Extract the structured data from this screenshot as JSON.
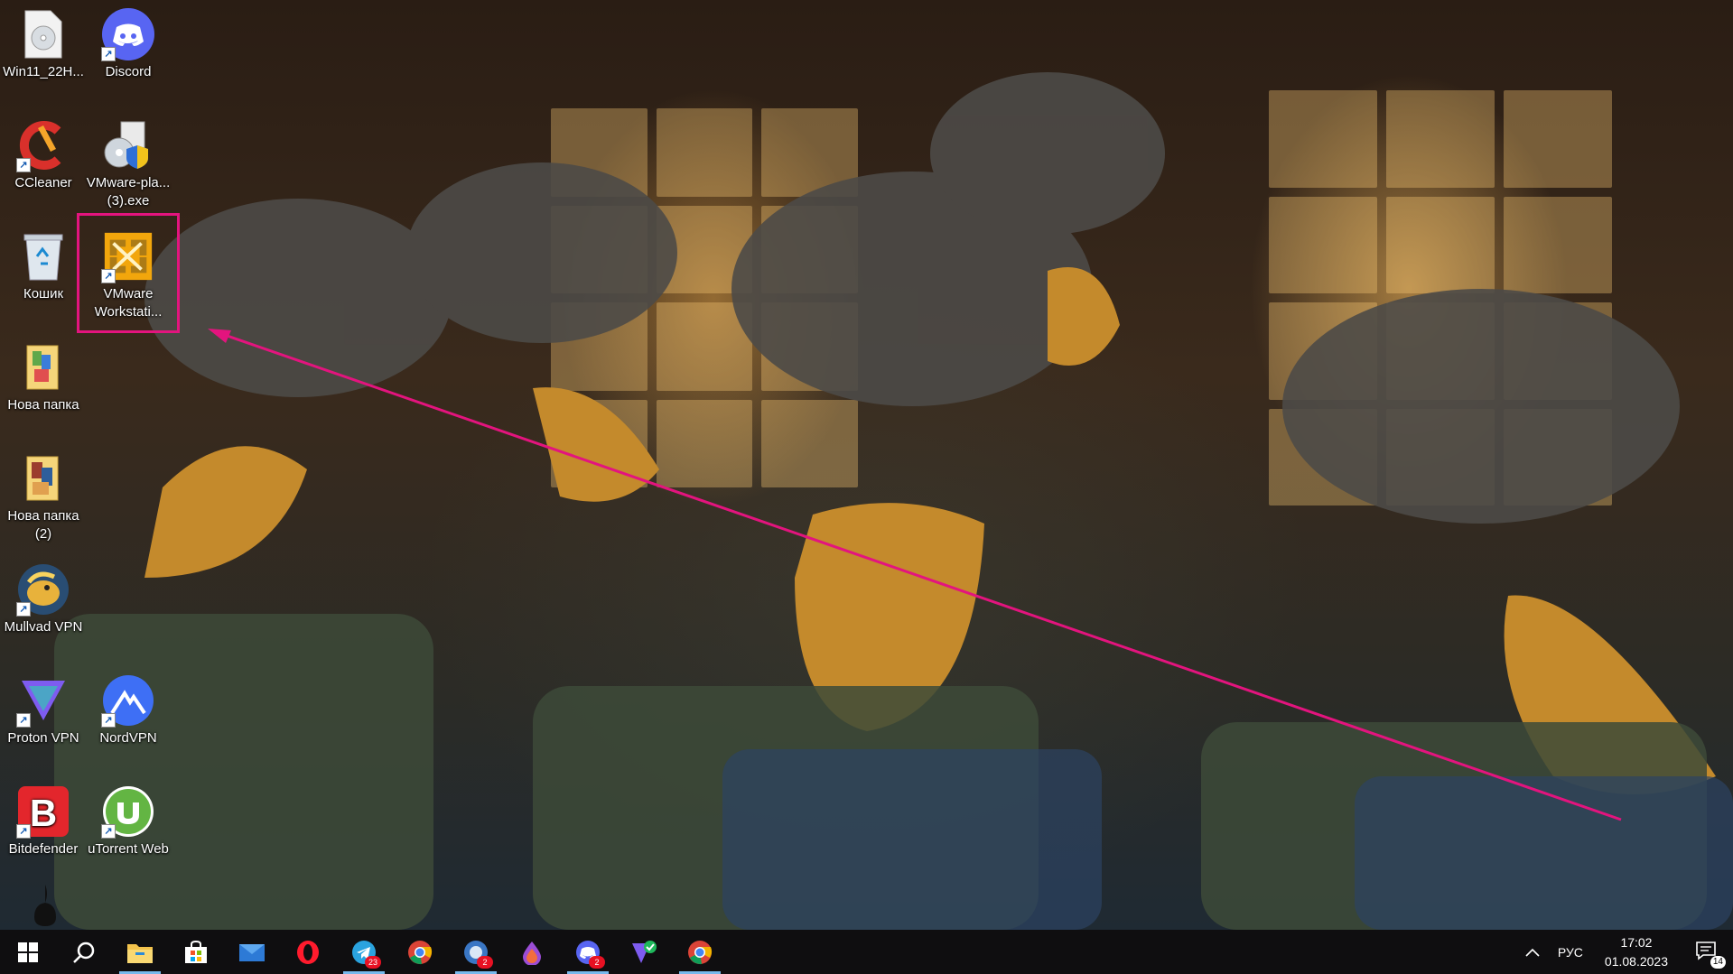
{
  "desktop": {
    "icons": [
      {
        "label": "Win11_22H..."
      },
      {
        "label": "Discord"
      },
      {
        "label": "CCleaner"
      },
      {
        "label": "VMware-pla...",
        "label2": "(3).exe"
      },
      {
        "label": "Кошик"
      },
      {
        "label": "VMware",
        "label2": "Workstati..."
      },
      {
        "label": "Нова папка"
      },
      {
        "label": "Нова папка",
        "label2": "(2)"
      },
      {
        "label": "Mullvad VPN"
      },
      {
        "label": "Proton VPN"
      },
      {
        "label": "NordVPN"
      },
      {
        "label": "Bitdefender"
      },
      {
        "label": "uTorrent Web"
      }
    ]
  },
  "taskbar": {
    "apps": [
      {
        "icon": "windows-start-icon"
      },
      {
        "icon": "search-icon"
      },
      {
        "icon": "file-explorer-icon"
      },
      {
        "icon": "microsoft-store-icon"
      },
      {
        "icon": "mail-icon"
      },
      {
        "icon": "opera-icon"
      },
      {
        "icon": "telegram-icon",
        "badge": "23"
      },
      {
        "icon": "chrome-icon"
      },
      {
        "icon": "app-icon",
        "badge": "2"
      },
      {
        "icon": "drop-icon"
      },
      {
        "icon": "discord-icon",
        "badge": "2"
      },
      {
        "icon": "vpn-icon"
      },
      {
        "icon": "chrome-icon"
      }
    ],
    "tray": {
      "language": "РУС",
      "time": "17:02",
      "date": "01.08.2023",
      "notifications": "14"
    }
  },
  "colors": {
    "highlight": "#e3147e",
    "taskbar": "#0e0e10",
    "accent": "#76b9ed"
  }
}
